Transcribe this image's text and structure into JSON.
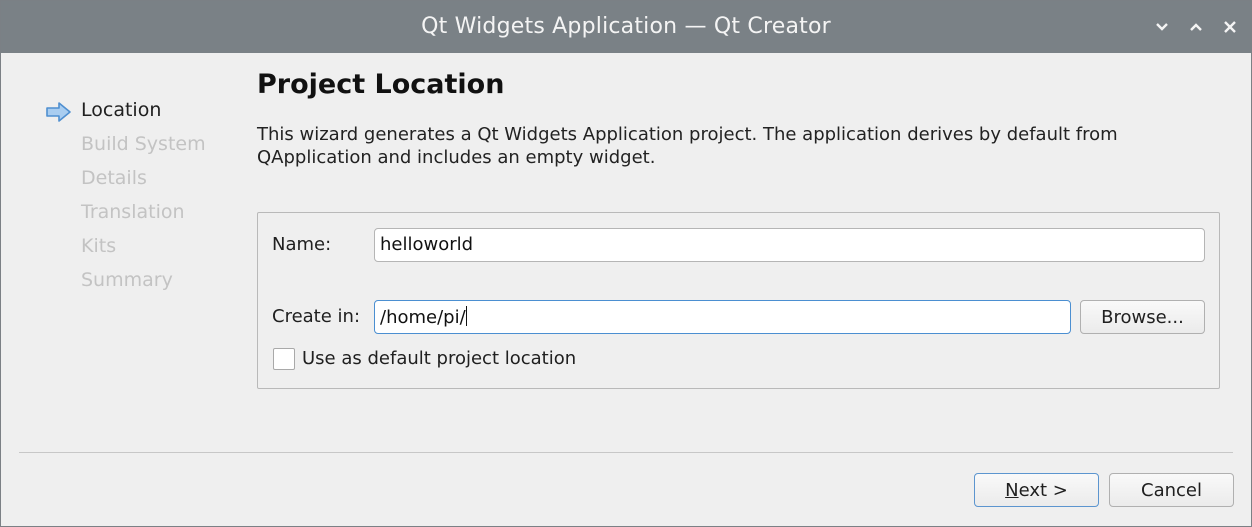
{
  "window": {
    "title": "Qt Widgets Application — Qt Creator",
    "controls": [
      "chevron-down-icon",
      "chevron-up-icon",
      "close-icon"
    ]
  },
  "sidebar": {
    "steps": [
      {
        "label": "Location",
        "active": true
      },
      {
        "label": "Build System",
        "active": false
      },
      {
        "label": "Details",
        "active": false
      },
      {
        "label": "Translation",
        "active": false
      },
      {
        "label": "Kits",
        "active": false
      },
      {
        "label": "Summary",
        "active": false
      }
    ]
  },
  "page": {
    "heading": "Project Location",
    "description_line1": "This wizard generates a Qt Widgets Application project. The application derives by default from",
    "description_line2": "QApplication and includes an empty widget."
  },
  "form": {
    "name_label": "Name:",
    "name_value": "helloworld",
    "create_in_label": "Create in:",
    "create_in_value": "/home/pi/",
    "browse_label": "Browse...",
    "default_location_label": "Use as default project location",
    "default_location_checked": false
  },
  "footer": {
    "next_label_mnemonic": "N",
    "next_label_rest": "ext >",
    "cancel_label": "Cancel"
  },
  "colors": {
    "titlebar": "#7a8186",
    "focus_border": "#4b8fd1",
    "step_arrow": "#5b9bdc",
    "inactive_step": "#c3c3c3"
  }
}
